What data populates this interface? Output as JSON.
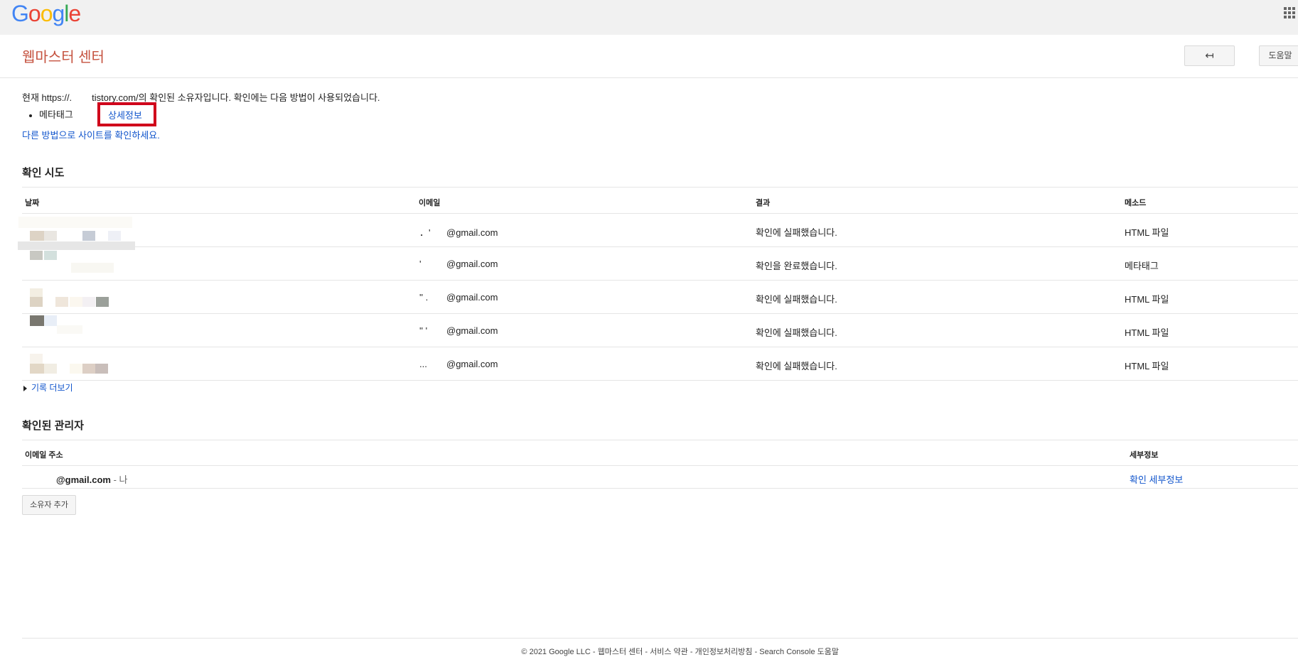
{
  "header": {
    "logo_letters": [
      "G",
      "o",
      "o",
      "g",
      "l",
      "e"
    ],
    "apps_icon": "apps-grid-icon"
  },
  "page": {
    "title": "웹마스터 센터",
    "back_label": "↤",
    "help_label": "도움말"
  },
  "intro": {
    "prefix": "현재 https://.",
    "suffix": "tistory.com/의 확인된 소유자입니다. 확인에는 다음 방법이 사용되었습니다.",
    "method": "메타태그",
    "detail_link": "상세정보",
    "other_method_link": "다른 방법으로 사이트를 확인하세요."
  },
  "attempts": {
    "title": "확인 시도",
    "columns": [
      "날짜",
      "이메일",
      "결과",
      "메소드"
    ],
    "rows": [
      {
        "email_mask": "．'",
        "email": "@gmail.com",
        "result": "확인에 실패했습니다.",
        "method": "HTML 파일"
      },
      {
        "email_mask": "'",
        "email": "@gmail.com",
        "result": "확인을 완료했습니다.",
        "method": "메타태그"
      },
      {
        "email_mask": "'' .",
        "email": "@gmail.com",
        "result": "확인에 실패했습니다.",
        "method": "HTML 파일"
      },
      {
        "email_mask": "''  '",
        "email": "@gmail.com",
        "result": "확인에 실패했습니다.",
        "method": "HTML 파일"
      },
      {
        "email_mask": "...",
        "email": "@gmail.com",
        "result": "확인에 실패했습니다.",
        "method": "HTML 파일"
      }
    ],
    "more_link": "기록 더보기"
  },
  "owners": {
    "title": "확인된 관리자",
    "columns": [
      "이메일 주소",
      "세부정보"
    ],
    "email": "@gmail.com",
    "me_label": "- 나",
    "detail_link": "확인 세부정보",
    "add_button": "소유자 추가"
  },
  "footer": {
    "text": "© 2021 Google LLC - 웹마스터 센터 - 서비스 약관 - 개인정보처리방침 - Search Console 도움말"
  },
  "colors": {
    "title": "#c5523f",
    "link": "#1155cc",
    "highlight_box": "#d0021b",
    "topbar": "#f1f1f1"
  }
}
